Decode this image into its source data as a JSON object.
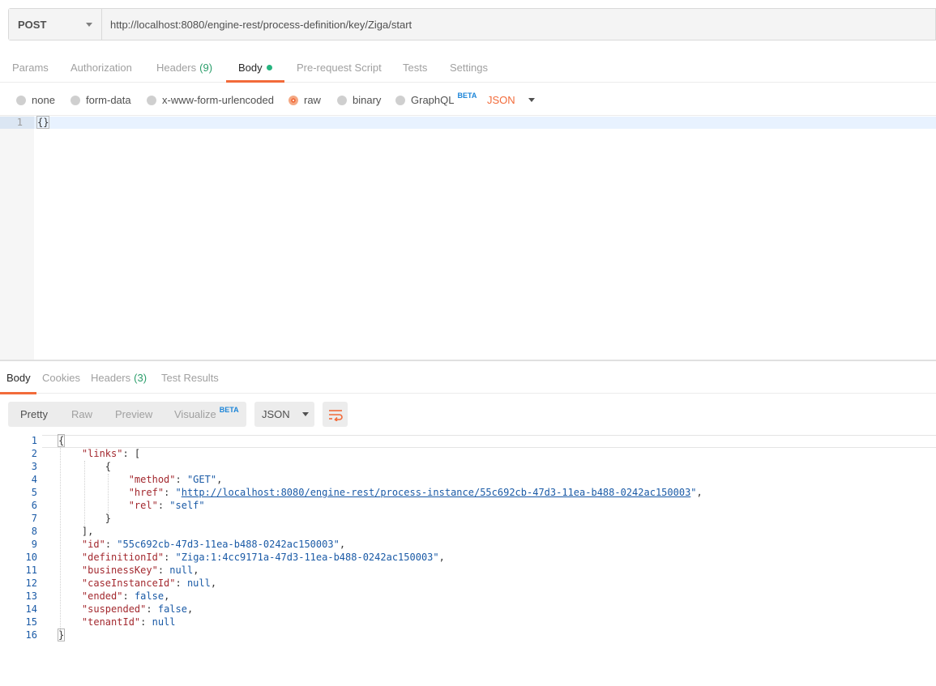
{
  "request": {
    "method": "POST",
    "url": "http://localhost:8080/engine-rest/process-definition/key/Ziga/start"
  },
  "request_tabs": {
    "params": "Params",
    "authorization": "Authorization",
    "headers": "Headers",
    "headers_count": "(9)",
    "body": "Body",
    "prerequest": "Pre-request Script",
    "tests": "Tests",
    "settings": "Settings"
  },
  "body_types": {
    "none": "none",
    "form_data": "form-data",
    "urlencoded": "x-www-form-urlencoded",
    "raw": "raw",
    "binary": "binary",
    "graphql": "GraphQL",
    "graphql_badge": "BETA",
    "selected": "raw",
    "format": "JSON"
  },
  "request_editor": {
    "line_number": "1",
    "content": "{}"
  },
  "response_tabs": {
    "body": "Body",
    "cookies": "Cookies",
    "headers": "Headers",
    "headers_count": "(3)",
    "test_results": "Test Results"
  },
  "response_toolbar": {
    "pretty": "Pretty",
    "raw": "Raw",
    "preview": "Preview",
    "visualize": "Visualize",
    "visualize_badge": "BETA",
    "format": "JSON"
  },
  "response_body": {
    "line_numbers": [
      "1",
      "2",
      "3",
      "4",
      "5",
      "6",
      "7",
      "8",
      "9",
      "10",
      "11",
      "12",
      "13",
      "14",
      "15",
      "16"
    ],
    "links_key": "\"links\"",
    "method_key": "\"method\"",
    "method_val": "\"GET\"",
    "href_key": "\"href\"",
    "href_val": "http://localhost:8080/engine-rest/process-instance/55c692cb-47d3-11ea-b488-0242ac150003",
    "rel_key": "\"rel\"",
    "rel_val": "\"self\"",
    "id_key": "\"id\"",
    "id_val": "\"55c692cb-47d3-11ea-b488-0242ac150003\"",
    "definitionId_key": "\"definitionId\"",
    "definitionId_val": "\"Ziga:1:4cc9171a-47d3-11ea-b488-0242ac150003\"",
    "businessKey_key": "\"businessKey\"",
    "businessKey_val": "null",
    "caseInstanceId_key": "\"caseInstanceId\"",
    "caseInstanceId_val": "null",
    "ended_key": "\"ended\"",
    "ended_val": "false",
    "suspended_key": "\"suspended\"",
    "suspended_val": "false",
    "tenantId_key": "\"tenantId\"",
    "tenantId_val": "null"
  },
  "colors": {
    "accent": "#f26b3a",
    "count_green": "#2a9d6a",
    "beta_blue": "#1c85d8",
    "json_key": "#a3292f",
    "json_value": "#1a5aa6"
  }
}
